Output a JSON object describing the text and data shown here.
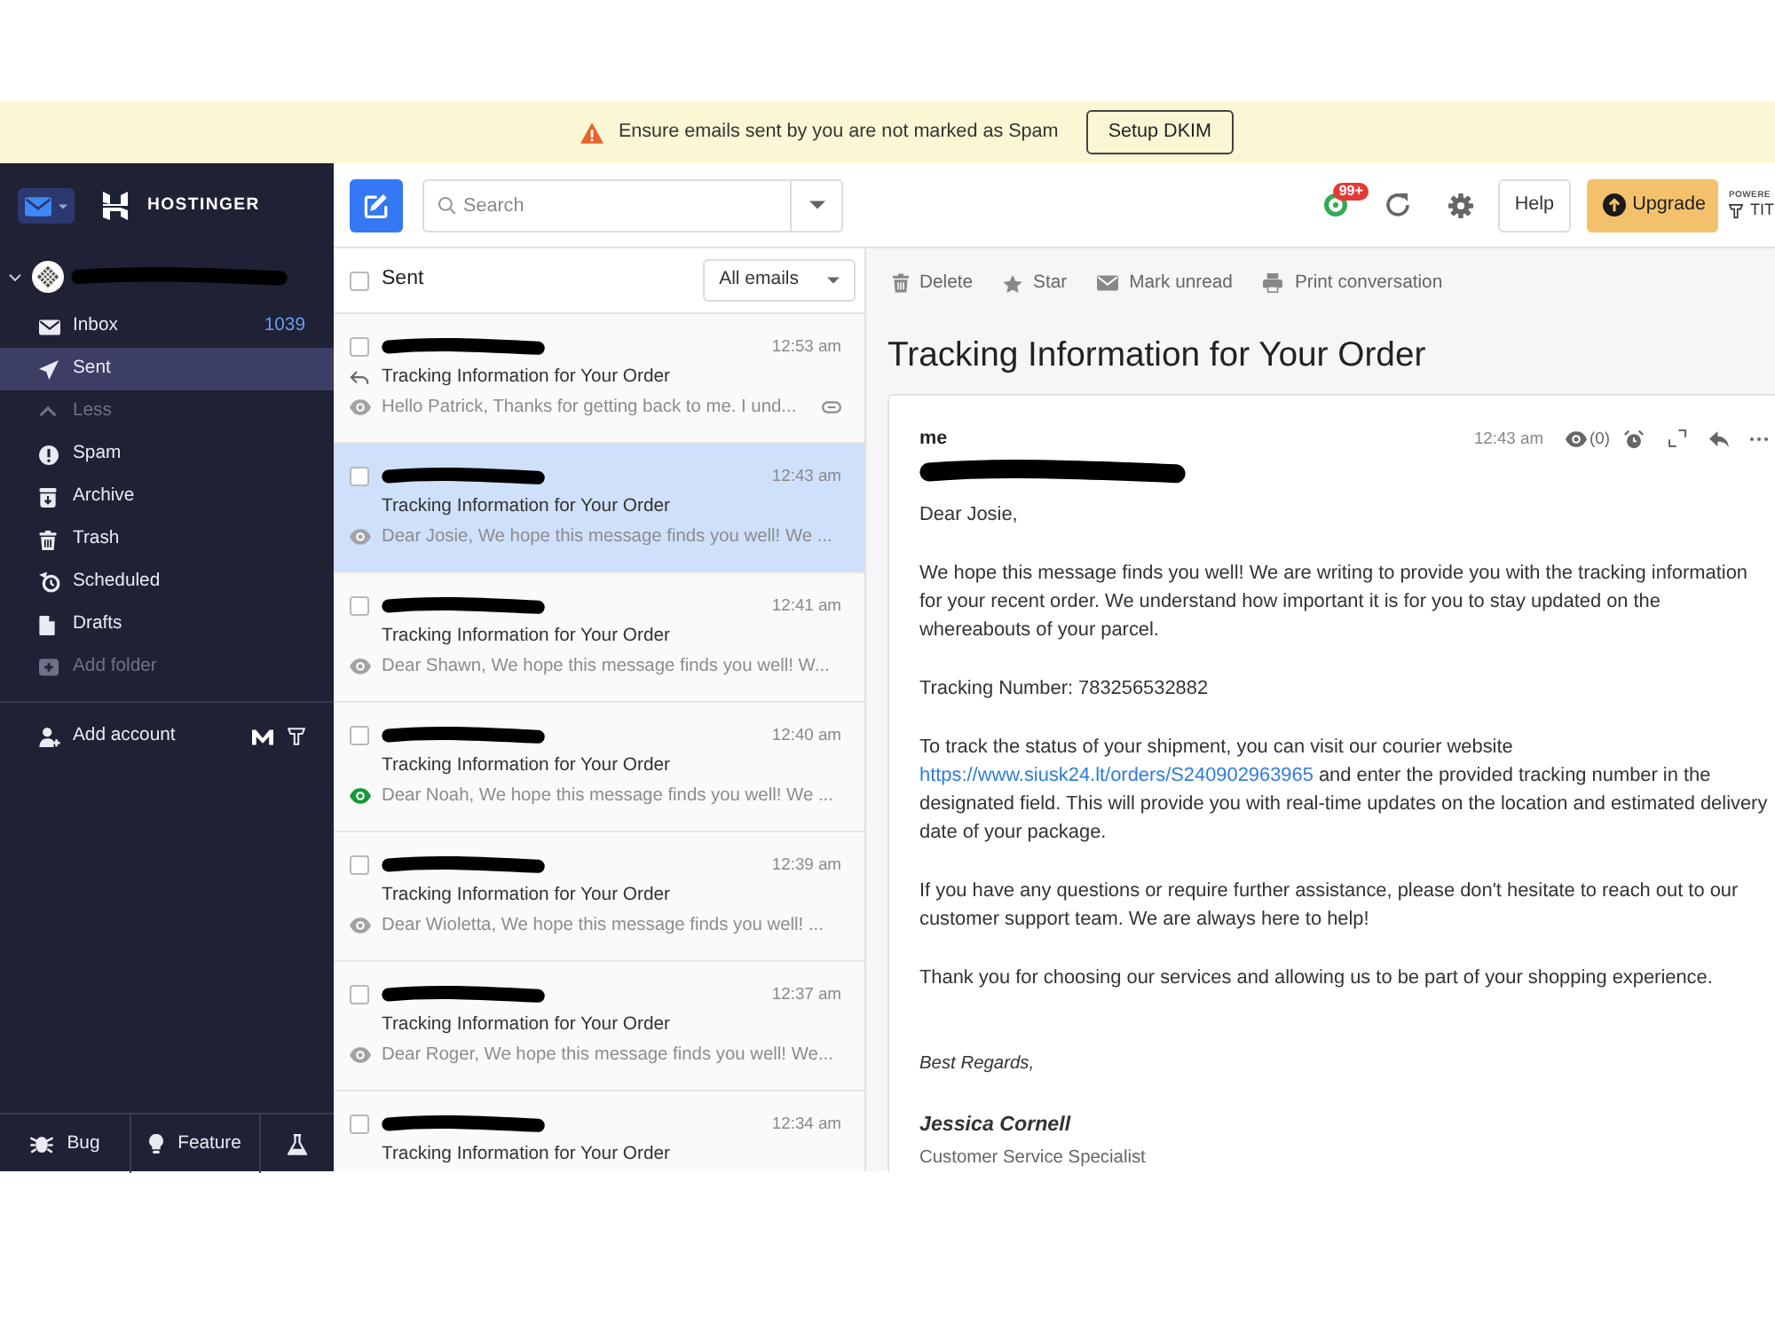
{
  "banner": {
    "message": "Ensure emails sent by you are not marked as Spam",
    "button": "Setup DKIM"
  },
  "header": {
    "brand": "HOSTINGER",
    "search_placeholder": "Search",
    "notification_badge": "99+",
    "help": "Help",
    "upgrade": "Upgrade",
    "powered_by": "POWERE",
    "partner": "TIT"
  },
  "sidebar": {
    "account": {
      "expanded": true,
      "redacted": true
    },
    "folders": [
      {
        "label": "Inbox",
        "kind": "folder",
        "count": "1039",
        "selected": false
      },
      {
        "label": "Sent",
        "kind": "folder",
        "selected": true
      },
      {
        "label": "Less",
        "kind": "toggle",
        "selected": false
      },
      {
        "label": "Spam",
        "kind": "folder",
        "selected": false
      },
      {
        "label": "Archive",
        "kind": "folder",
        "selected": false
      },
      {
        "label": "Trash",
        "kind": "folder",
        "selected": false
      },
      {
        "label": "Scheduled",
        "kind": "folder",
        "selected": false
      },
      {
        "label": "Drafts",
        "kind": "folder",
        "selected": false
      },
      {
        "label": "Add folder",
        "kind": "action",
        "selected": false
      }
    ],
    "add_account": "Add account",
    "footer": {
      "bug": "Bug",
      "feature": "Feature"
    }
  },
  "list": {
    "title": "Sent",
    "checked": false,
    "filter": "All emails",
    "messages": [
      {
        "redacted": true,
        "time": "12:53 am",
        "subject": "Tracking Information for Your Order",
        "preview": "Hello Patrick, Thanks for getting back to me. I und...",
        "replied": true,
        "opened": false,
        "linked": true,
        "checked": false,
        "selected": false
      },
      {
        "redacted": true,
        "time": "12:43 am",
        "subject": "Tracking Information for Your Order",
        "preview": "Dear Josie, We hope this message finds you well! We ...",
        "replied": false,
        "opened": false,
        "linked": false,
        "checked": false,
        "selected": true
      },
      {
        "redacted": true,
        "time": "12:41 am",
        "subject": "Tracking Information for Your Order",
        "preview": "Dear Shawn, We hope this message finds you well! W...",
        "replied": false,
        "opened": false,
        "linked": false,
        "checked": false,
        "selected": false
      },
      {
        "redacted": true,
        "time": "12:40 am",
        "subject": "Tracking Information for Your Order",
        "preview": "Dear Noah, We hope this message finds you well! We ...",
        "replied": false,
        "opened": true,
        "linked": false,
        "checked": false,
        "selected": false
      },
      {
        "redacted": true,
        "time": "12:39 am",
        "subject": "Tracking Information for Your Order",
        "preview": "Dear Wioletta, We hope this message finds you well! ...",
        "replied": false,
        "opened": false,
        "linked": false,
        "checked": false,
        "selected": false
      },
      {
        "redacted": true,
        "time": "12:37 am",
        "subject": "Tracking Information for Your Order",
        "preview": "Dear Roger, We hope this message finds you well! We...",
        "replied": false,
        "opened": false,
        "linked": false,
        "checked": false,
        "selected": false
      },
      {
        "redacted": true,
        "time": "12:34 am",
        "subject": "Tracking Information for Your Order",
        "replied": false,
        "checked": false,
        "selected": false
      }
    ]
  },
  "reader": {
    "actions": [
      "Delete",
      "Star",
      "Mark unread",
      "Print conversation"
    ],
    "title": "Tracking Information for Your Order",
    "message": {
      "from": "me",
      "recipient_redacted": true,
      "time": "12:43 am",
      "views": "(0)",
      "paragraphs": [
        {
          "text": "Dear Josie,"
        },
        {
          "text": "We hope this message finds you well! We are writing to provide you with the tracking information for your recent order. We understand how important it is for you to stay updated on the whereabouts of your parcel."
        },
        {
          "text": "Tracking Number: 783256532882"
        },
        {
          "text": "To track the status of your shipment, you can visit our courier website",
          "link": "https://www.siusk24.lt/orders/S240902963965",
          "after": "and enter the provided tracking number in the designated field. This will provide you with real-time updates on the location and estimated delivery date of your package."
        },
        {
          "text": "If you have any questions or require further assistance, please don't hesitate to reach out to our customer support team. We are always here to help!"
        },
        {
          "text": "Thank you for choosing our services and allowing us to be part of your shopping experience."
        }
      ],
      "signoff": "Best Regards,",
      "signature_name": "Jessica Cornell",
      "signature_title": "Customer Service Specialist"
    }
  }
}
